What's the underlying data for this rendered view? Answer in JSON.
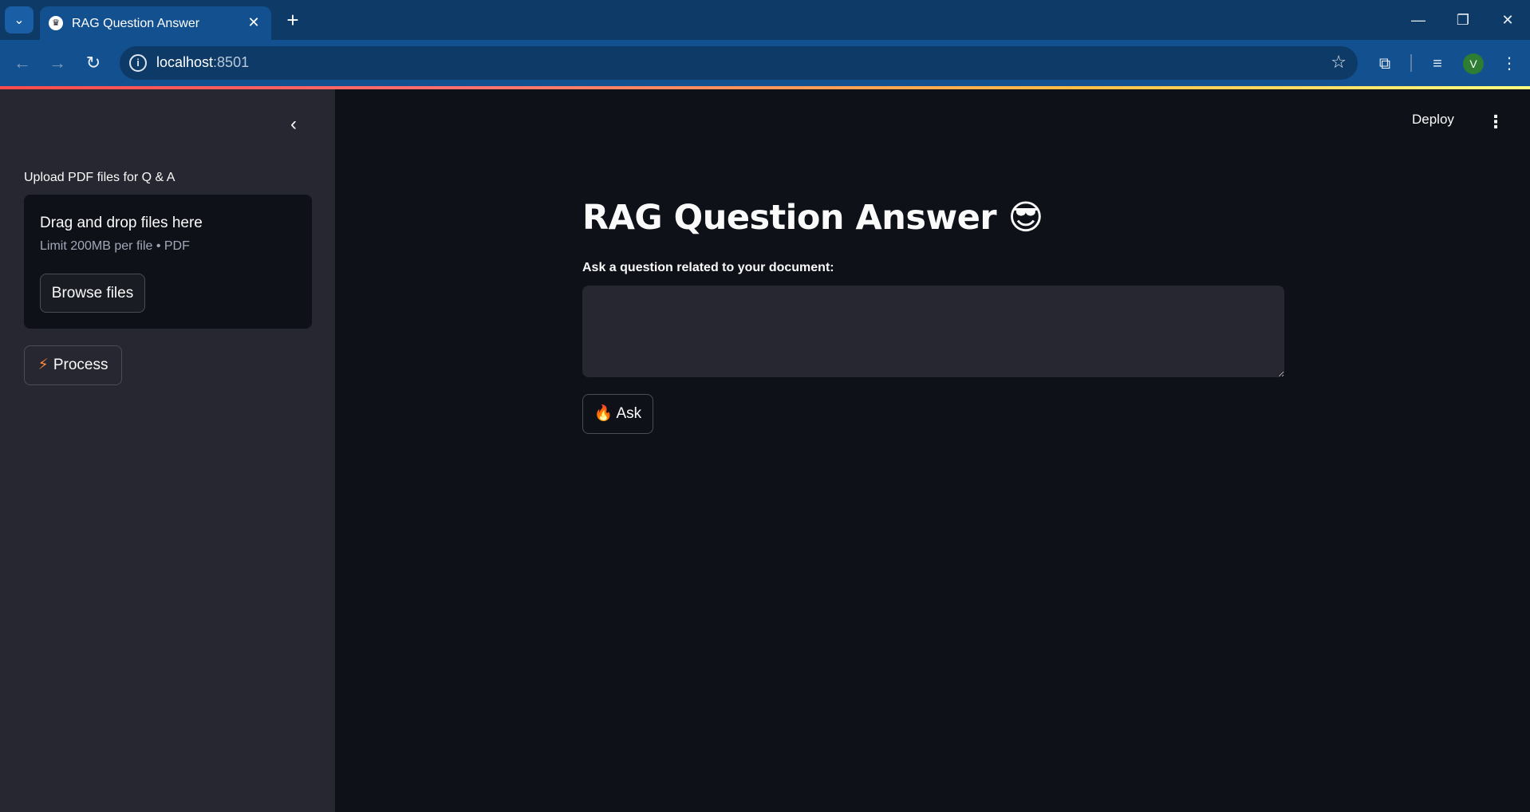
{
  "browser": {
    "tab": {
      "title": "RAG Question Answer",
      "favicon": "crown-icon",
      "close": "✕"
    },
    "tab_search_icon": "⌄",
    "new_tab_icon": "+",
    "window_controls": {
      "minimize": "—",
      "restore": "❐",
      "close": "✕"
    },
    "nav": {
      "back": "←",
      "forward": "→",
      "reload": "↻"
    },
    "address": {
      "host": "localhost",
      "port": ":8501"
    },
    "star_icon": "☆",
    "extensions_icon": "⧉",
    "media_icon": "≡",
    "profile_initial": "V",
    "menu_icon": "⋮",
    "accent_colors": {
      "tabbar": "#0d3a66",
      "toolbar": "#12508f"
    }
  },
  "sidebar": {
    "collapse_icon": "‹",
    "upload_label": "Upload PDF files for Q & A",
    "dropzone": {
      "title": "Drag and drop files here",
      "subtitle": "Limit 200MB per file • PDF",
      "browse_label": "Browse files"
    },
    "process_button": {
      "icon": "⚡",
      "label": "Process"
    }
  },
  "header": {
    "deploy_label": "Deploy",
    "menu_icon": "⋮"
  },
  "main": {
    "title": "RAG Question Answer 😎",
    "question_label": "Ask a question related to your document:",
    "question_value": "",
    "ask_button": {
      "icon": "🔥",
      "label": "Ask"
    }
  }
}
